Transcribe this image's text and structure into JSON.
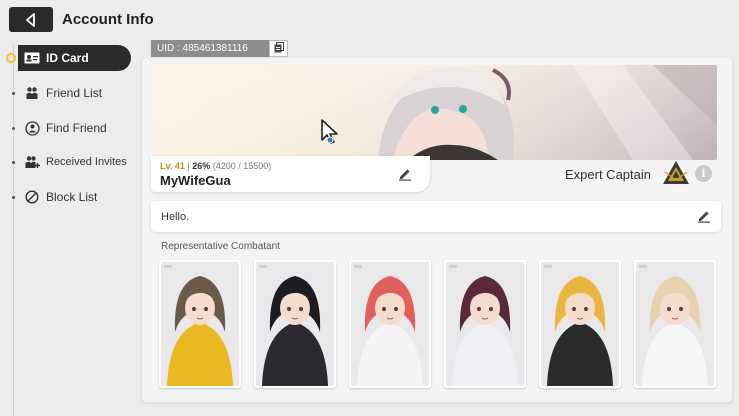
{
  "header": {
    "title": "Account Info",
    "back_icon": "back-arrow-icon"
  },
  "sidebar": {
    "items": [
      {
        "label": "ID Card",
        "icon": "id-card-icon",
        "active": true
      },
      {
        "label": "Friend List",
        "icon": "friends-icon",
        "active": false
      },
      {
        "label": "Find Friend",
        "icon": "find-friend-icon",
        "active": false
      },
      {
        "label": "Received Invites",
        "icon": "invites-icon",
        "active": false
      },
      {
        "label": "Block List",
        "icon": "block-icon",
        "active": false
      }
    ]
  },
  "profile": {
    "uid": "UID : 485461381116",
    "level_label": "Lv. 41",
    "exp_percent": "26%",
    "exp_detail": "(4200 / 15500)",
    "nickname": "MyWifeGua",
    "rank_title": "Expert Captain",
    "info_glyph": "i",
    "greeting": "Hello."
  },
  "combatants": {
    "section_label": "Representative Combatant",
    "portraits": [
      {
        "hair": "#6b5a48",
        "outfit": "#e8b923"
      },
      {
        "hair": "#1c1c22",
        "outfit": "#2a2a30"
      },
      {
        "hair": "#e0605c",
        "outfit": "#f4f4f4"
      },
      {
        "hair": "#5a2a3c",
        "outfit": "#f0f0f4"
      },
      {
        "hair": "#e8b640",
        "outfit": "#2b2b2b"
      },
      {
        "hair": "#e6d2b0",
        "outfit": "#f6f6f6"
      }
    ]
  },
  "colors": {
    "accent_gold": "#f2c230",
    "dark": "#2b2b2b"
  }
}
